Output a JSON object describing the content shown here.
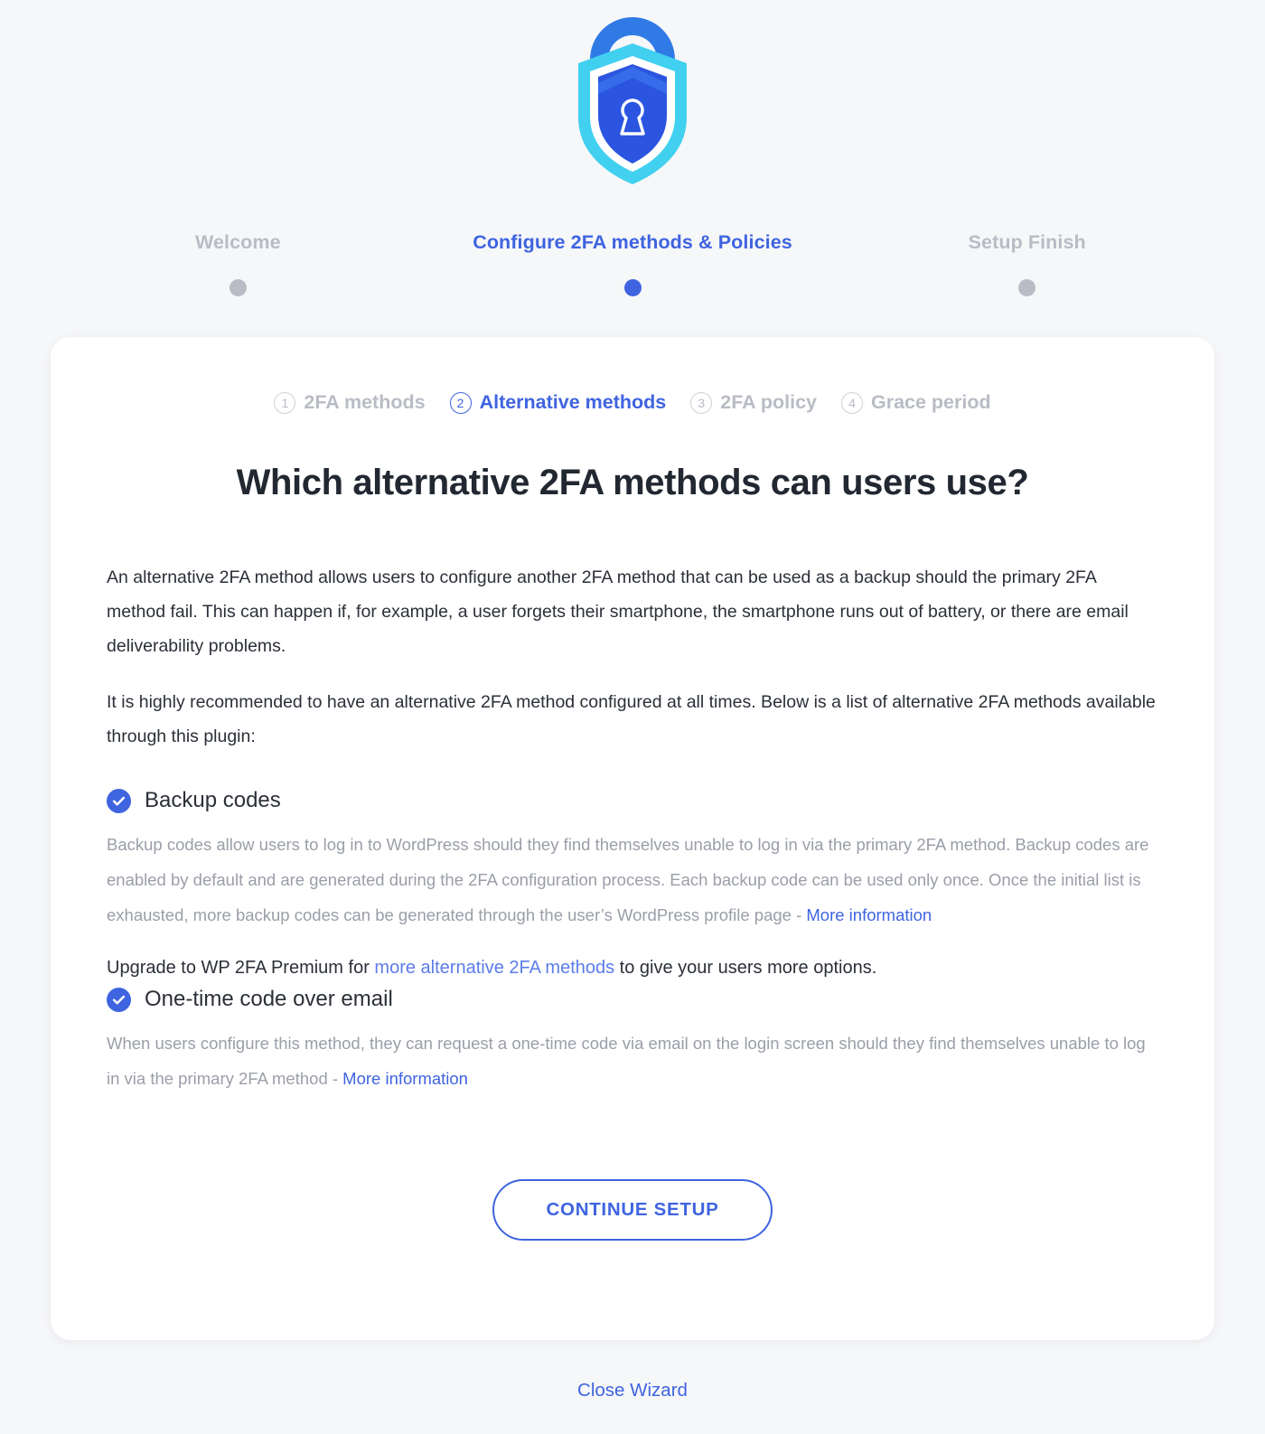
{
  "logo": {
    "name": "wp-2fa-shield-lock-logo",
    "colors": {
      "outer_cyan": "#41d0f0",
      "arch_blue": "#2f7ae5",
      "inner_blue": "#2b55e0",
      "white": "#ffffff"
    }
  },
  "progress": {
    "steps": [
      {
        "label": "Welcome",
        "active": false
      },
      {
        "label": "Configure 2FA methods & Policies",
        "active": true
      },
      {
        "label": "Setup Finish",
        "active": false
      }
    ]
  },
  "substeps": [
    {
      "num": "1",
      "label": "2FA methods",
      "active": false
    },
    {
      "num": "2",
      "label": "Alternative methods",
      "active": true
    },
    {
      "num": "3",
      "label": "2FA policy",
      "active": false
    },
    {
      "num": "4",
      "label": "Grace period",
      "active": false
    }
  ],
  "card": {
    "heading": "Which alternative 2FA methods can users use?",
    "paragraph_1": "An alternative 2FA method allows users to configure another 2FA method that can be used as a backup should the primary 2FA method fail. This can happen if, for example, a user forgets their smartphone, the smartphone runs out of battery, or there are email deliverability problems.",
    "paragraph_2": "It is highly recommended to have an alternative 2FA method configured at all times. Below is a list of alternative 2FA methods available through this plugin:",
    "methods": [
      {
        "label": "Backup codes",
        "checked": true,
        "description": "Backup codes allow users to log in to WordPress should they find themselves unable to log in via the primary 2FA method. Backup codes are enabled by default and are generated during the 2FA configuration process. Each backup code can be used only once. Once the initial list is exhausted, more backup codes can be generated through the user’s WordPress profile page - ",
        "link_text": "More information"
      },
      {
        "label": "One-time code over email",
        "checked": true,
        "description": "When users configure this method, they can request a one-time code via email on the login screen should they find themselves unable to log in via the primary 2FA method - ",
        "link_text": "More information"
      }
    ],
    "upgrade": {
      "prefix": "Upgrade to WP 2FA Premium for ",
      "link_text": "more alternative 2FA methods",
      "suffix": " to give your users more options."
    },
    "continue_label": "CONTINUE SETUP"
  },
  "footer": {
    "close_label": "Close Wizard"
  },
  "theme": {
    "accent": "#3f64e0",
    "muted": "#b9bcc4",
    "body_text": "#2b2f38",
    "desc_text": "#9a9ea8",
    "page_bg": "#f6f7f9",
    "card_bg": "#ffffff"
  }
}
